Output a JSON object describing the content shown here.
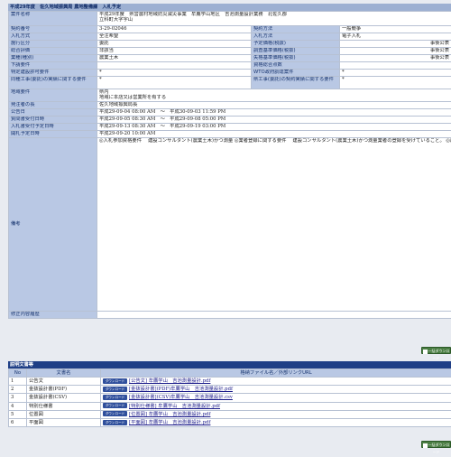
{
  "header": {
    "title": "平成29年度　佐久地域振興局 農地整備課　入札予定"
  },
  "details": {
    "anken_name_label": "案件名称",
    "anken_name_lines": [
      "平成29年度　県営農村地域防災減災事業　牟鷹学山地区　吉池測量設計業務　北佐久郡",
      "立科町大字宇山"
    ],
    "keiyaku_bango_label": "契約番号",
    "keiyaku_bango": "3-29-02046",
    "keiyaku_hoho_label": "契約方法",
    "keiyaku_hoho": "一般競争",
    "nyusatsu_hoshiki_label": "入札方式",
    "nyusatsu_hoshiki": "全注希望",
    "nyusatsu_hoho_label": "入札方法",
    "nyusatsu_hoho": "電子入札",
    "kogyo_kubun_label": "施行区分",
    "kogyo_kubun": "委託",
    "yotei_kakaku_label": "予定価格(税抜)",
    "yotei_kakaku": "事後公表",
    "sogo_hyoka_label": "総合評価",
    "sogo_hyoka": "非該当",
    "chosa_kijun_label": "調査基準価格(税抜)",
    "chosa_kijun": "事後公表",
    "gyoshu_label": "業種(種別)",
    "gyoshu": "農業土木",
    "shikkaku_kijun_label": "失格基準価格(税抜)",
    "shikkaku_kijun": "事後公表",
    "shitauke_label": "下請要件",
    "shitauke": "",
    "shikaku_sogo_label": "資格総合点数",
    "shikaku_sogo": "",
    "tokutei_label": "特定建設許可要件",
    "tokutei": "*",
    "wto_label": "WTO政府調達案件",
    "wto": "*",
    "dogyo_label": "同種工事(委託)の実績に関する要件",
    "dogyo": "*",
    "kenmin_label": "県工事(委託)の契約実績に関する要件",
    "kenmin": "*",
    "chiiki_label": "地域要件",
    "chiiki_lines": [
      "県内",
      "地域に本店又は営業所を有する"
    ],
    "hatchu_label": "発注者の長",
    "hatchu": "佐久地域振興局長",
    "kokoku_label": "公告日",
    "kokoku": "平成29-09-04 08:00 AM　〜　平成30-09-03 11:59 PM",
    "shitsumon_label": "質問書受付日時",
    "shitsumon": "平成29-09-05 08:30 AM　〜　平成29-09-08 05:00 PM",
    "nyusatsusho_label": "入札書受付予定日時",
    "nyusatsusho": "平成29-09-13 08:30 AM　〜　平成29-09-19 03:00 PM",
    "kaisatsu_label": "開札予定日時",
    "kaisatsu": "平成29-09-20 10:00 AM",
    "biko_label": "備考",
    "biko": "◎入札参加資格要件\n　建設コンサルタント(農業土木)かつ測量\n\n◎業者登録に関する要件\n　建設コンサルタント(農業土木)かつ測量業者の登録を受けていること。\n\n◎配置技術者に関する要件\n　管理技術者として次の技術者のいずれかを配置できること。及び主任技術者\nとして兼務して配置できること。(管理技術者と兼務可)\n・技術士　農業部門(農業土木)\n・認定技術管理者(農業土木部門)\n・RCCM(農業土木部門)\n\n　照査技術者として、次の技術者のいずれかを配置できること。(管理技術者及\nび主任技術者と兼務不可)\n・技術士　農業部門(農業土木)又は総合技術監理(科目指定なし)\n・認定技術管理者(農業土木部門)\n・RCCM(農業土木部門)\n\n◎営業所の所在地に関する要件\n　県内に本店又は営業所を有していること。(ただし、県外本店の県内営業所は、\n当該入札に係る業種の入札参加資格を有している営業所に限る。)\n\n◎その他の参加資格要件\n　公告日時点で所属技術士又はRCCM又は認定技術管理者のいずれかの資格を\n有する者が3人以上いること。\n\n◎お願い\n　ファックスにより質問を送付した方は、回答に正確を期するため、送信した旨の\n御一報を御面倒でもお願いいたします。",
    "shusei_label": "修正内容履歴",
    "shusei": ""
  },
  "buttons": {
    "download_all": "一括ダウンロード",
    "mini_download": "ダウンロード"
  },
  "docs_section": {
    "title": "説明文書等",
    "col_no": "No",
    "col_name": "文書名",
    "col_file": "格納ファイル名／外部リンクURL",
    "rows": [
      {
        "no": "1",
        "name": "公告文",
        "file": "[公告文] 牟鷹学山　吉池測量設計.pdf"
      },
      {
        "no": "2",
        "name": "金抜設計書(PDF)",
        "file": "[金抜設計書](PDF)牟鷹学山　吉池測量設計.pdf"
      },
      {
        "no": "3",
        "name": "金抜設計書(CSV)",
        "file": "[金抜設計書](CSV)牟鷹学山　吉池測量設計.csv"
      },
      {
        "no": "4",
        "name": "特別仕様書",
        "file": "[特別仕様書] 牟鷹学山　吉池測量設計.pdf"
      },
      {
        "no": "5",
        "name": "位置図",
        "file": "[位置図] 牟鷹学山　吉池測量設計.pdf"
      },
      {
        "no": "6",
        "name": "平面図",
        "file": "[平面図] 牟鷹学山　吉池測量設計.pdf"
      }
    ]
  }
}
